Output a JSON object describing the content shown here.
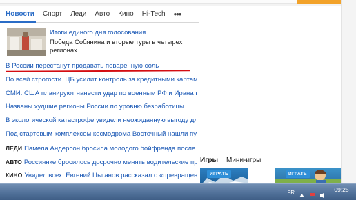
{
  "tabs": {
    "items": [
      "Новости",
      "Спорт",
      "Леди",
      "Авто",
      "Кино",
      "Hi-Tech"
    ],
    "more": "•••"
  },
  "feature": {
    "headline": "Итоги единого дня голосования",
    "subtitle": "Победа Собянина и вторые туры в четырех регионах"
  },
  "news": [
    {
      "tag": "",
      "text": "В России перестанут продавать поваренную соль"
    },
    {
      "tag": "",
      "text": "По всей строгости. ЦБ усилит контроль за кредитными картами"
    },
    {
      "tag": "",
      "text": "СМИ: США планируют нанести удар по военным РФ и Ирана в Сирии"
    },
    {
      "tag": "",
      "text": "Названы худшие регионы России по уровню безработицы"
    },
    {
      "tag": "",
      "text": "В экологической катастрофе увидели неожиданную выгоду для России"
    },
    {
      "tag": "",
      "text": "Под стартовым комплексом космодрома Восточный нашли пустоты"
    },
    {
      "tag": "ЛЕДИ",
      "text": "Памела Андерсон бросила молодого бойфренда после полугода"
    },
    {
      "tag": "АВТО",
      "text": "Россиянке бросилось досрочно менять водительские права"
    },
    {
      "tag": "КИНО",
      "text": "Увидел всех: Евгений Цыганов рассказал о «превращении»"
    }
  ],
  "games": {
    "tab_games": "Игры",
    "tab_mini": "Мини-игры",
    "play_label": "ИГРАТЬ"
  },
  "taskbar": {
    "lang": "FR",
    "time": "09:25"
  },
  "colors": {
    "link": "#1a58b5",
    "accent": "#2a6cc6",
    "annotation": "#d40d12",
    "search_button": "#f2a22a"
  }
}
